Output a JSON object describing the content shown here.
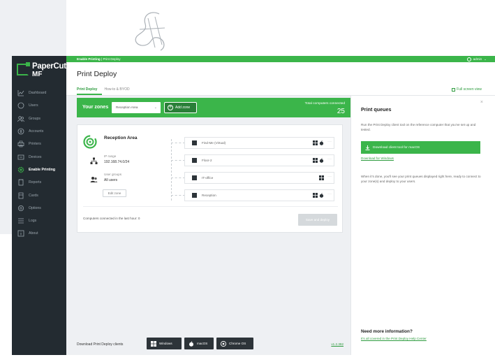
{
  "app": {
    "logo_line1": "PaperCut",
    "logo_line2": "MF",
    "accent": "#3bb54a"
  },
  "topbar": {
    "breadcrumb_root": "Enable Printing",
    "breadcrumb_sep": "|",
    "breadcrumb_current": "Print Deploy",
    "user": "admin"
  },
  "sidebar": {
    "items": [
      {
        "label": "Dashboard",
        "icon": "chart-icon",
        "active": false
      },
      {
        "label": "Users",
        "icon": "user-icon",
        "active": false
      },
      {
        "label": "Groups",
        "icon": "group-icon",
        "active": false
      },
      {
        "label": "Accounts",
        "icon": "accounts-icon",
        "active": false
      },
      {
        "label": "Printers",
        "icon": "printer-icon",
        "active": false
      },
      {
        "label": "Devices",
        "icon": "device-icon",
        "active": false
      },
      {
        "label": "Enable Printing",
        "icon": "gear-icon",
        "active": true
      },
      {
        "label": "Reports",
        "icon": "report-icon",
        "active": false
      },
      {
        "label": "Cards",
        "icon": "card-icon",
        "active": false
      },
      {
        "label": "Options",
        "icon": "options-icon",
        "active": false
      },
      {
        "label": "Logs",
        "icon": "logs-icon",
        "active": false
      },
      {
        "label": "About",
        "icon": "about-icon",
        "active": false
      }
    ]
  },
  "header": {
    "title": "Print Deploy",
    "tabs": [
      {
        "label": "Print Deploy",
        "active": true
      },
      {
        "label": "How-to & BYOD",
        "active": false
      }
    ],
    "fullscreen_link": "Full screen view"
  },
  "zones": {
    "label": "Your zones",
    "selected_zone": "Reception Area",
    "add_zone": "Add zone",
    "total_label": "Total computers connected",
    "total_value": "25"
  },
  "zone_card": {
    "name": "Reception Area",
    "ip_label": "IP range",
    "ip_value": "192.168.74.0/24",
    "groups_label": "User groups",
    "groups_value": "All users",
    "edit_button": "Edit zone",
    "queues": [
      {
        "name": "Find-Me (Virtual)",
        "os": [
          "windows",
          "mac"
        ],
        "more": "···"
      },
      {
        "name": "Floor-2",
        "os": [
          "windows",
          "mac"
        ],
        "more": "···"
      },
      {
        "name": "IT-office",
        "os": [
          "windows"
        ],
        "more": "···"
      },
      {
        "name": "Reception",
        "os": [
          "windows",
          "mac"
        ],
        "more": "···"
      }
    ],
    "connected_text": "Computers connected in the last hour: 0",
    "save_button": "Save and deploy"
  },
  "footer": {
    "label": "Download Print Deploy clients",
    "buttons": [
      "Windows",
      "macOS",
      "Chrome OS"
    ],
    "version": "v1.2.392"
  },
  "right_panel": {
    "title": "Print queues",
    "close": "×",
    "description": "Run the Print Deploy client tool on the reference computer that you've set up and tested.",
    "download_button": "Download client tool for macOS",
    "windows_link": "Download for Windows",
    "after_text": "When it's done, you'll see your print queues displayed right here, ready to connect to your zone(s) and deploy to your users.",
    "need_more": "Need more information?",
    "help_link": "It's all covered in the Print Deploy Help Center"
  }
}
